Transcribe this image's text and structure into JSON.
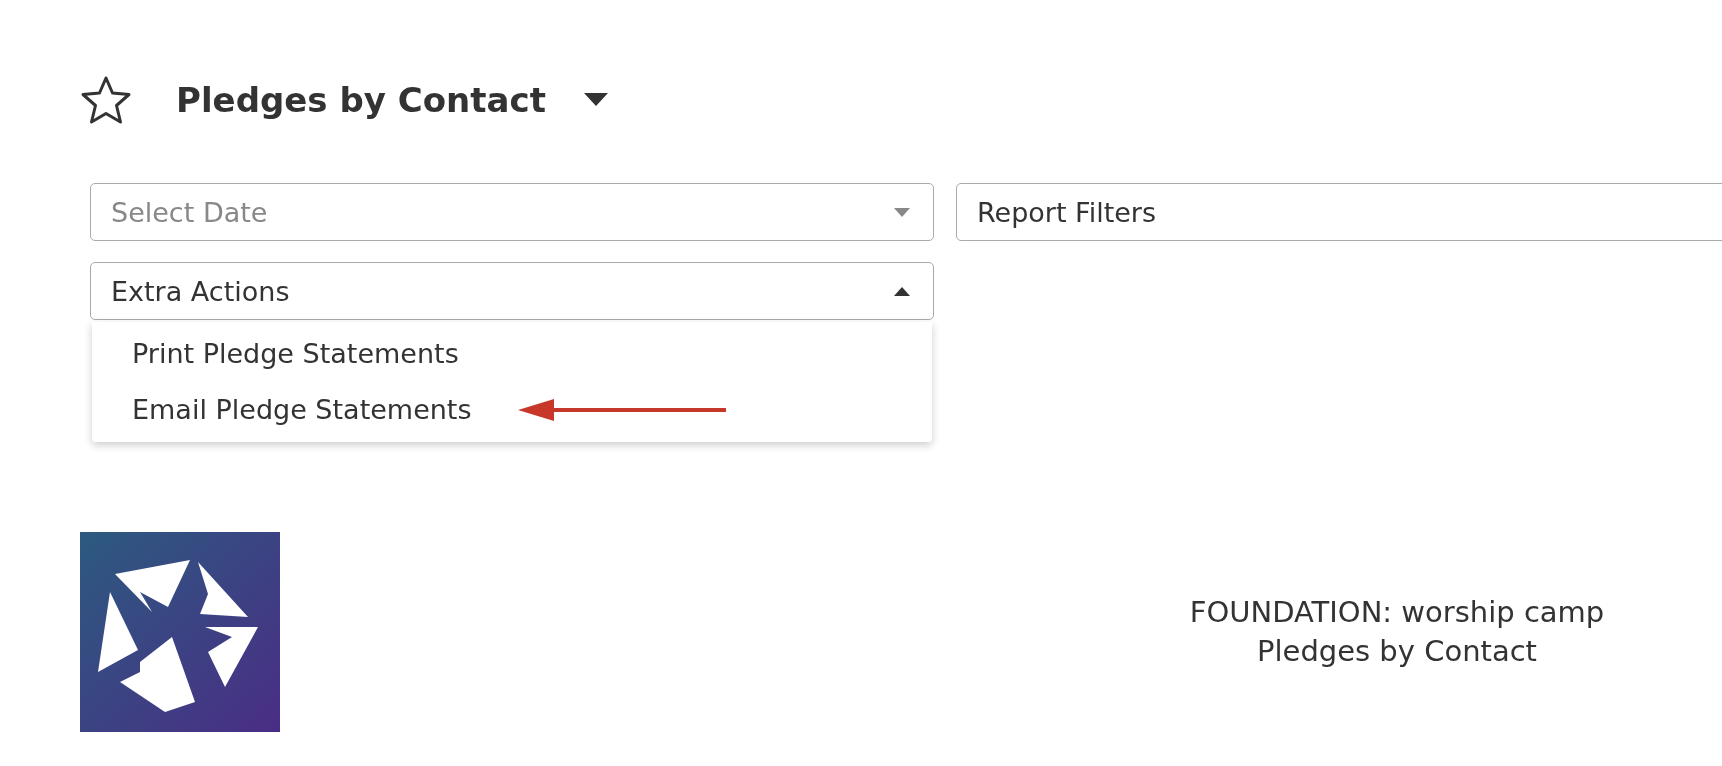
{
  "header": {
    "title": "Pledges by Contact",
    "favorite": false
  },
  "date_select": {
    "placeholder": "Select Date"
  },
  "report_filters": {
    "label": "Report Filters"
  },
  "extra_actions": {
    "label": "Extra Actions",
    "expanded": true,
    "items": [
      {
        "label": "Print Pledge Statements",
        "highlighted": false
      },
      {
        "label": "Email Pledge Statements",
        "highlighted": true
      }
    ]
  },
  "footer": {
    "lines": [
      "FOUNDATION: worship camp",
      "Pledges by Contact"
    ]
  }
}
